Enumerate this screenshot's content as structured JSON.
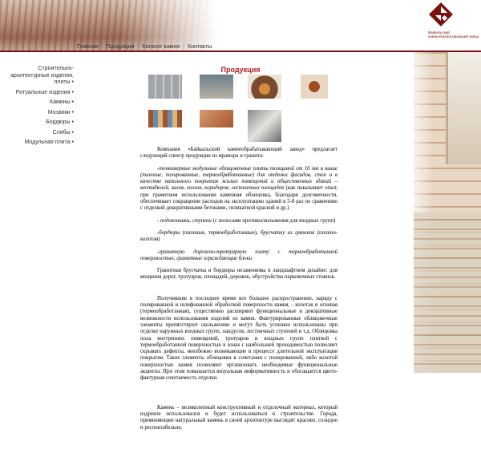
{
  "nav": [
    "Главная",
    "Продукция",
    "Каталог камня",
    "Контакты"
  ],
  "logo_text": "Байкальский камнеобрабатывающий завод",
  "sidebar": [
    "Строительно-архитектурные изделия, плиты",
    "Ритуальные изделия",
    "Камины",
    "Мозаики",
    "Бордюры",
    "Слябы",
    "Модульная плита"
  ],
  "page_title": "Продукция",
  "paragraphs": {
    "p1": "Компания «Байкальский камнеобрабатывающий завод» предлагает следующий спектр продукции из мрамора и гранита:",
    "p2_italic": "-тонкомерные модульные облицовочные плиты толщиной от 10 мм и выше (пиленые, полированные, термообработанные) для отделки фасадов, стен и в качестве напольного покрытия жилых помещений и общественных зданий – вестибюлей, залов, холлов, коридоров, лестничных площадок",
    "p2_rest": " (как показывает опыт, при грамотном использовании каменная облицовка, благодаря долговечности, обеспечивает сокращение расходов на эксплуатацию зданий в 5-8 раз по сравнению с отделкой декоративными бетонами, силикатной краской и др.)",
    "p3_italic": "- подоконники, ступени",
    "p3_rest": " (с полосами противоскольжения для входных групп)",
    "p4_italic": "-бордюры",
    "p4_mid": " (пиленые, термообработанные), ",
    "p4_italic2": "брусчатку из гранита",
    "p4_rest": " (пилено-колотая)",
    "p5_italic": "-гранитную дорожно-тротуарную плиту с термообработанной поверхностью, гранитные ограждающие блоки",
    "p6": "Гранитная брусчатка и бордюры незаменимы в ландшафтном дизайне: для мощения дорог, тротуаров, площадей, дорожек, обустройства парковочных стоянок.",
    "p7": "Получившие в последнее время все большее распространение, наряду с полированной и шлифованной обработкой поверхности камня, - колотая и огневая (термообработанная), существенно расширяют функциональные и декоративные возможности использования изделий из камня. Фактурированные облицовочные элементы препятствуют скольжению и могут быть успешно использованы при отделке наружных входных групп, пандусов, лестничных ступеней и т.д. Облицовка пола внутренних помещений, тротуаров и входных групп плиткой с термообработанной поверхностью в зонах с наибольшей проходимостью позволяет скрывать дефекты, неизбежно возникающие в процессе длительной эксплуатации покрытия. Такие элементы облицовки в сочетании с полированной, либо колотой поверхностью камня позволяют организовать необходимые функциональные акценты. При этом повышается визуальная информативность и обогащается цвето-фактурная сочетаемость отделки.",
    "p8": "Камень – великолепный конструктивный и отделочный материал, который издревле использовался и будет использоваться в строительстве. Города, применяющие натуральный камень в своей архитектуре выглядят красиво, солидно и респектабельно."
  },
  "colors": {
    "accent": "#7b1212",
    "title": "#b01c1c"
  }
}
